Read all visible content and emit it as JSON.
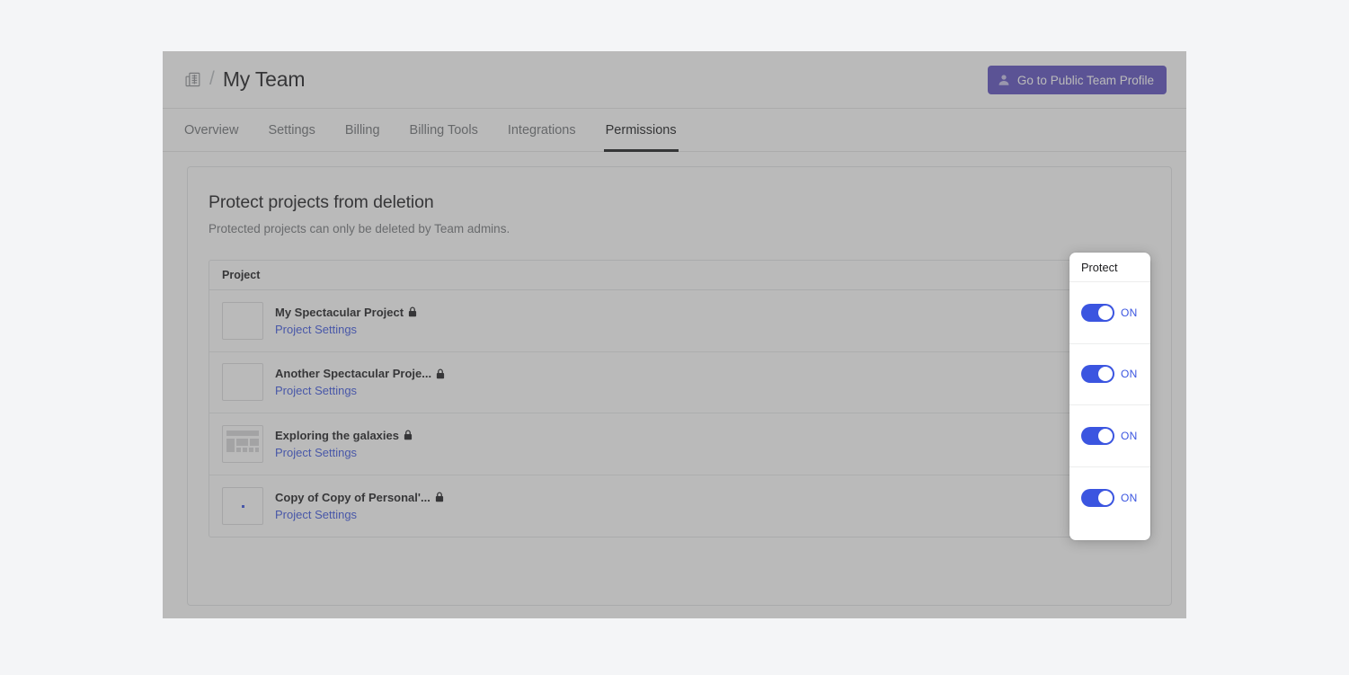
{
  "header": {
    "breadcrumb_icon": "building-icon",
    "breadcrumb_separator": "/",
    "team_title": "My Team",
    "profile_button": {
      "label": "Go to Public Team Profile",
      "icon": "person-icon",
      "color": "#5c4ec0"
    }
  },
  "tabs": [
    {
      "label": "Overview",
      "active": false
    },
    {
      "label": "Settings",
      "active": false
    },
    {
      "label": "Billing",
      "active": false
    },
    {
      "label": "Billing Tools",
      "active": false
    },
    {
      "label": "Integrations",
      "active": false
    },
    {
      "label": "Permissions",
      "active": true
    }
  ],
  "section": {
    "title": "Protect projects from deletion",
    "subtitle": "Protected projects can only be deleted by Team admins."
  },
  "table": {
    "columns": [
      "Project",
      "Protect"
    ],
    "settings_link_label": "Project Settings",
    "lock_icon": "lock-icon",
    "rows": [
      {
        "name": "My Spectacular Project",
        "locked": true,
        "link": "Project Settings",
        "thumbnail": "blank-thumbnail",
        "protect": {
          "state": "ON",
          "on": true
        }
      },
      {
        "name": "Another Spectacular Proje...",
        "locked": true,
        "link": "Project Settings",
        "thumbnail": "blank-thumbnail",
        "protect": {
          "state": "ON",
          "on": true
        }
      },
      {
        "name": "Exploring the galaxies",
        "locked": true,
        "link": "Project Settings",
        "thumbnail": "wireframe-thumbnail",
        "protect": {
          "state": "ON",
          "on": true
        }
      },
      {
        "name": "Copy of Copy of Personal'...",
        "locked": true,
        "link": "Project Settings",
        "thumbnail": "dot-thumbnail",
        "protect": {
          "state": "ON",
          "on": true
        }
      }
    ]
  },
  "protect_panel": {
    "header": "Protect",
    "toggle_on_color": "#3b55e0",
    "cells": [
      {
        "label": "ON"
      },
      {
        "label": "ON"
      },
      {
        "label": "ON"
      },
      {
        "label": "ON"
      }
    ]
  }
}
